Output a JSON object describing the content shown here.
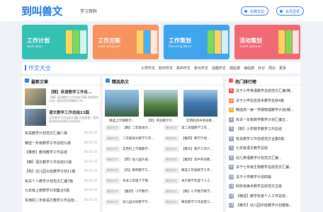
{
  "header": {
    "logo": "到叫兽文",
    "nav": "学习资料",
    "favorite": "收藏本站",
    "login": "会员登录"
  },
  "cards": [
    {
      "title": "工作计划",
      "sub": "work plan",
      "bg": "#35c1b2"
    },
    {
      "title": "工作方案",
      "sub": "work program",
      "bg": "#f7935e"
    },
    {
      "title": "工作策划",
      "sub": "Planning Work",
      "bg": "#3fa4ee"
    },
    {
      "title": "活动策划",
      "sub": "event planner",
      "bg": "#ef6a73"
    }
  ],
  "section": {
    "title": "作文大全",
    "tabs": [
      "小学作文",
      "初中作文",
      "高中作文",
      "单元作文",
      "话题作文",
      "观后感",
      "读后感",
      "日记",
      "周记"
    ],
    "more": "更多"
  },
  "latest": {
    "title": "最新文章",
    "featured": [
      {
        "title": "【精】英语教学工作总...",
        "desc": "【精】英语教学工作总结15篇 总结是对过去一段时间内所做的工作..."
      },
      {
        "title": "语文教学工作总结13篇",
        "desc": "语文教学工作总结13篇 总结是把一定阶段内的有关情况分析研究..."
      }
    ],
    "items": [
      {
        "t": "有关教学计划范文汇编八篇",
        "d": "24-01-15"
      },
      {
        "t": "精选一年级教学工作总结九篇",
        "d": "24-01-15"
      },
      {
        "t": "【推荐】教师教学工作总结",
        "d": "24-01-15"
      },
      {
        "t": "【精】语文教学工作总结11篇",
        "d": "24-01-15"
      },
      {
        "t": "【热】幼儿园大班教学计划11篇",
        "d": "24-01-15"
      },
      {
        "t": "有关个人教学计划范文汇编7篇",
        "d": "24-01-15"
      },
      {
        "t": "九年级上册数学计划集合5篇",
        "d": "24-01-15"
      },
      {
        "t": "实用的二年级语文教学工作总结...",
        "d": "24-01-15"
      }
    ]
  },
  "hot": {
    "title": "精选热文",
    "photos": [
      "精选上学期教学...",
      "【荐】英语教学计...",
      "实用的高中英语教..."
    ],
    "rows": [
      [
        "精选作文",
        "【精】二年级语文...",
        "精选作文",
        "高二地理教学工作..."
      ],
      [
        "精选作文",
        "二年级语文教学工作...",
        "精选作文",
        "【推荐】教学计划..."
      ],
      [
        "精选作文",
        "实用的上学期教学...",
        "精选作文",
        "【精华】教学工作计..."
      ],
      [
        "精选作文",
        "【荐】幼儿园大班...",
        "精选作文",
        "【推荐】高中英语教..."
      ],
      [
        "精选作文",
        "【热】教师教学工...",
        "精选作文",
        "精选三年级教学工作..."
      ],
      [
        "精选作文",
        "有关三年级下学期...",
        "精选作文",
        "关于教学年度个人工..."
      ],
      [
        "精选作文",
        "【推荐】小学数学...",
        "精选作文",
        "【精】小学数学教学..."
      ],
      [
        "精选作文",
        "幼儿园大班教学计...",
        "精选作文",
        "精选教学工作总结三..."
      ]
    ]
  },
  "rank": {
    "title": "热门排行榜",
    "items": [
      "关于小学英语教学总结范文汇编(精...",
      "关于小学信息技术教学总结4篇",
      "精选高一第一学期物理教学计划(精...",
      "有关一年级数学教学计划汇编五...",
      "【荐】小学数学教学工作总结",
      "有关教学工作总结范文合集6篇",
      "七年级语文教学总结",
      "幼儿英语教学计划范文汇编...",
      "关于七年级生物教学总结范文汇编...",
      "关于小学教学计划四篇",
      "四年级美术教学总结范文五篇",
      "【精选】教学年度个人工作总结...",
      "【精华】幼儿园中班教学计划模板..."
    ],
    "colors": [
      "#f25a5a",
      "#f7935e",
      "#f7b23b",
      "#9aa6b8"
    ]
  }
}
